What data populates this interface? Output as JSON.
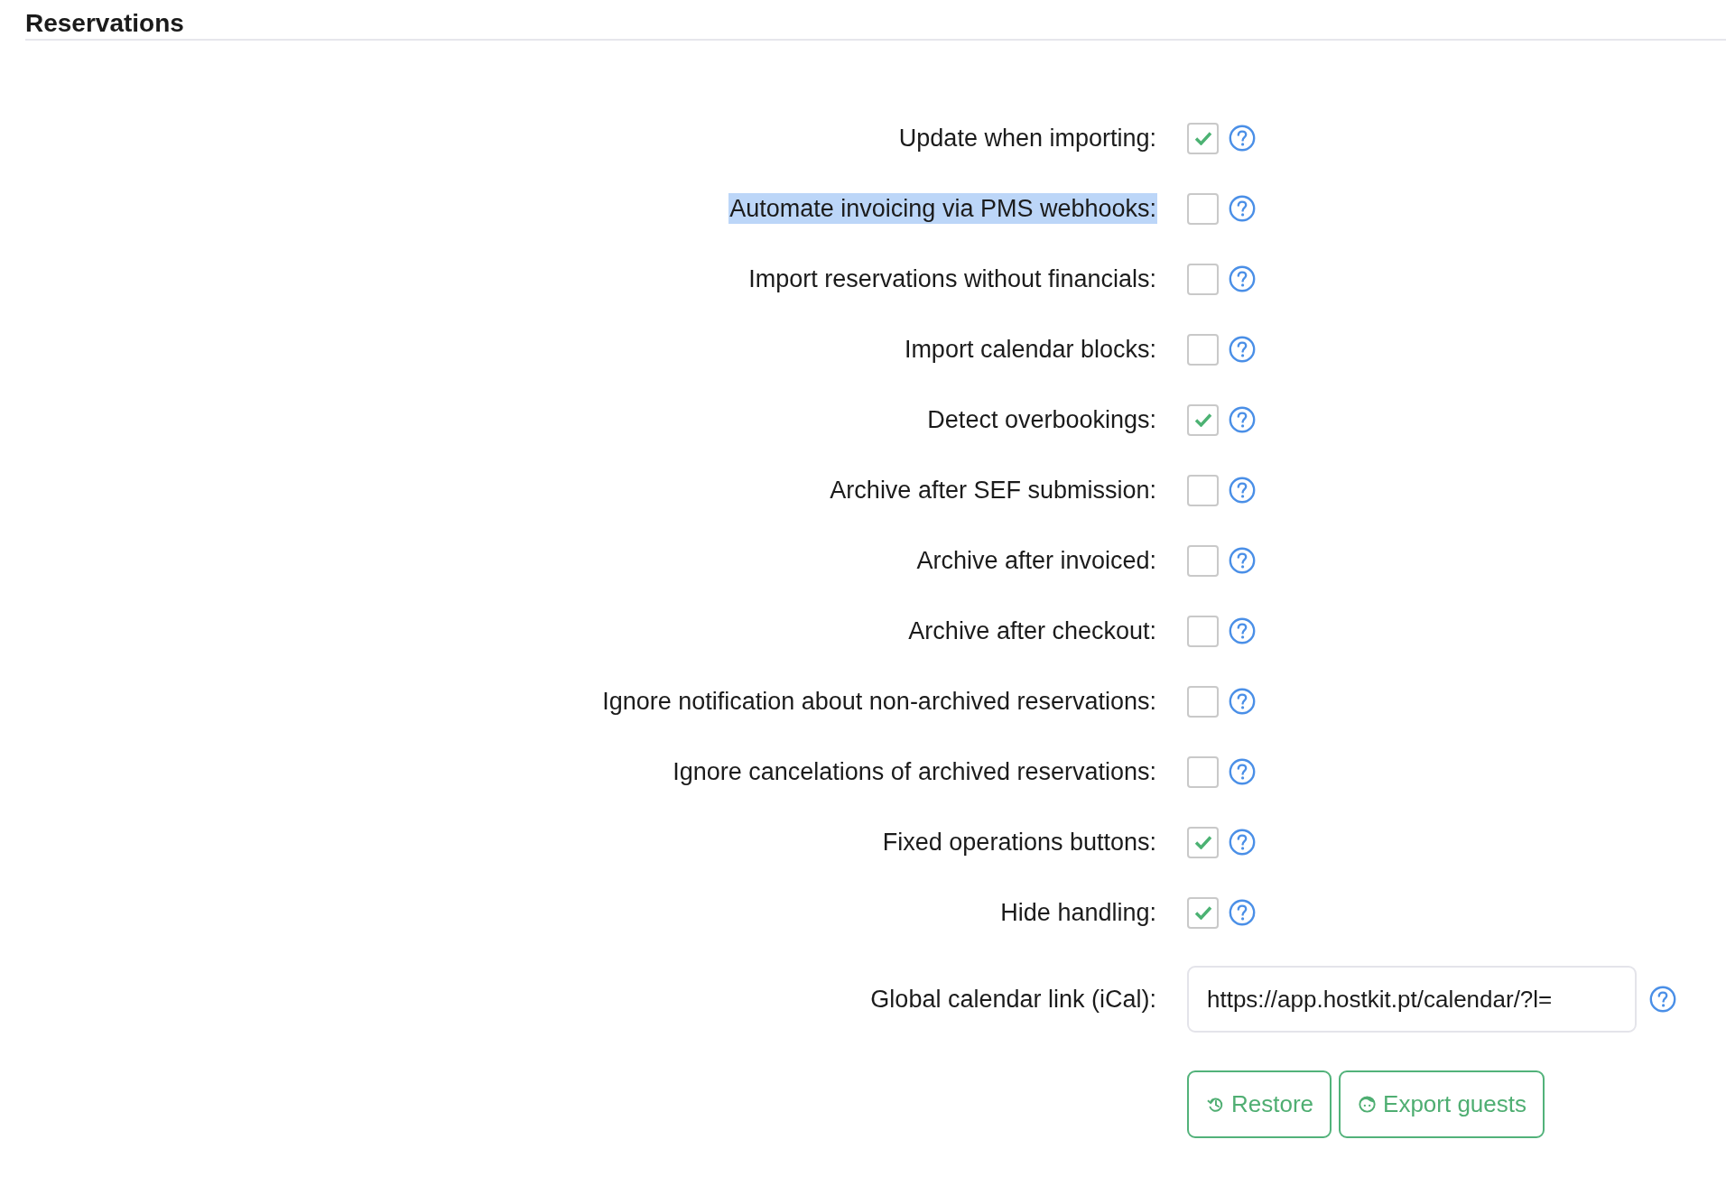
{
  "section": {
    "title": "Reservations"
  },
  "settings": [
    {
      "label": "Update when importing:",
      "checked": true,
      "highlighted": false
    },
    {
      "label": "Automate invoicing via PMS webhooks:",
      "checked": false,
      "highlighted": true
    },
    {
      "label": "Import reservations without financials:",
      "checked": false,
      "highlighted": false
    },
    {
      "label": "Import calendar blocks:",
      "checked": false,
      "highlighted": false
    },
    {
      "label": "Detect overbookings:",
      "checked": true,
      "highlighted": false
    },
    {
      "label": "Archive after SEF submission:",
      "checked": false,
      "highlighted": false
    },
    {
      "label": "Archive after invoiced:",
      "checked": false,
      "highlighted": false
    },
    {
      "label": "Archive after checkout:",
      "checked": false,
      "highlighted": false
    },
    {
      "label": "Ignore notification about non-archived reservations:",
      "checked": false,
      "highlighted": false
    },
    {
      "label": "Ignore cancelations of archived reservations:",
      "checked": false,
      "highlighted": false
    },
    {
      "label": "Fixed operations buttons:",
      "checked": true,
      "highlighted": false
    },
    {
      "label": "Hide handling:",
      "checked": true,
      "highlighted": false
    }
  ],
  "calendar_link": {
    "label": "Global calendar link (iCal):",
    "value": "https://app.hostkit.pt/calendar/?l="
  },
  "buttons": [
    {
      "label": "Restore",
      "kind": "restore"
    },
    {
      "label": "Export guests",
      "kind": "export"
    }
  ]
}
